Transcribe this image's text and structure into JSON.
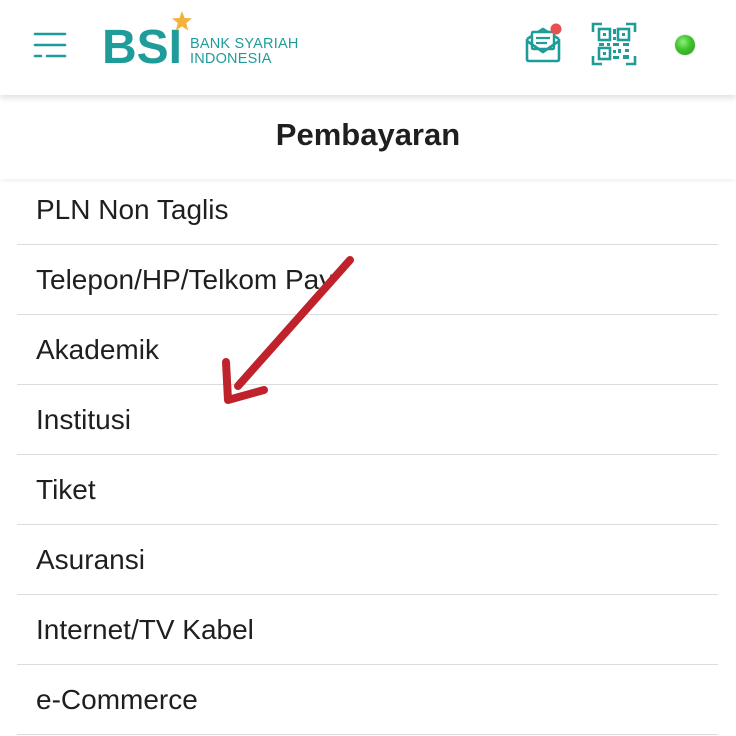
{
  "header": {
    "brand": "BSI",
    "brand_sub_line1": "BANK SYARIAH",
    "brand_sub_line2": "INDONESIA",
    "icons": {
      "menu": "hamburger-menu-icon",
      "inbox": "mail-notification-icon",
      "qr": "qr-code-icon",
      "status": "online-status-icon"
    },
    "colors": {
      "brand_teal": "#1f9c9a",
      "brand_star": "#f3b23a",
      "notification": "#e8504f",
      "status_online": "#3ec12b"
    }
  },
  "page": {
    "title": "Pembayaran"
  },
  "menu": {
    "items": [
      {
        "label": "PLN Non Taglis"
      },
      {
        "label": "Telepon/HP/Telkom Pay"
      },
      {
        "label": "Akademik"
      },
      {
        "label": "Institusi"
      },
      {
        "label": "Tiket"
      },
      {
        "label": "Asuransi"
      },
      {
        "label": "Internet/TV Kabel"
      },
      {
        "label": "e-Commerce"
      }
    ]
  },
  "annotation": {
    "arrow_color": "#c0222b",
    "arrow_target": "Institusi"
  }
}
